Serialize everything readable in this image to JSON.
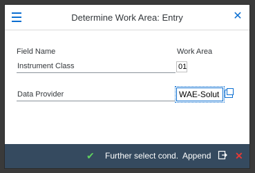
{
  "dialog": {
    "title": "Determine Work Area: Entry",
    "menu_icon": "hamburger-menu-icon",
    "close_icon": "close-icon",
    "field_name_header": "Field Name",
    "work_area_header": "Work Area",
    "rows": [
      {
        "label": "Instrument Class",
        "value": "01"
      },
      {
        "label": "Data Provider",
        "value": "WAE-Solut"
      }
    ]
  },
  "footer": {
    "confirm_icon": "check-icon",
    "further_select_label": "Further select cond.",
    "append_label": "Append",
    "export_icon": "export-icon",
    "cancel_icon": "cancel-icon"
  },
  "colors": {
    "accent": "#0a6ed1",
    "footer_bg": "#354a5f",
    "confirm": "#5fd05f",
    "cancel": "#e53935"
  }
}
